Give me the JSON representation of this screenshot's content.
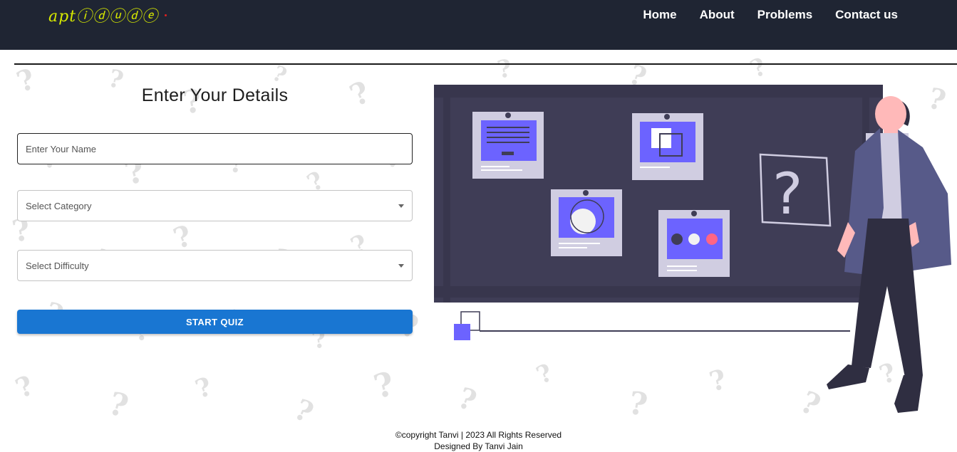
{
  "header": {
    "logo_text": "aptⓘⓓⓤⓓⓔ",
    "nav": [
      "Home",
      "About",
      "Problems",
      "Contact us"
    ]
  },
  "form": {
    "title": "Enter Your Details",
    "name_placeholder": "Enter Your Name",
    "category_label": "Select Category",
    "difficulty_label": "Select Difficulty",
    "start_label": "START QUIZ"
  },
  "footer": {
    "copyright": "©copyright Tanvi | 2023 All Rights Reserved",
    "designed_by": "Designed By Tanvi Jain"
  },
  "colors": {
    "navbar": "#1f2533",
    "accent": "#1976d2",
    "logo": "#d6e800",
    "board": "#3f3d56",
    "purple": "#6c63ff"
  }
}
